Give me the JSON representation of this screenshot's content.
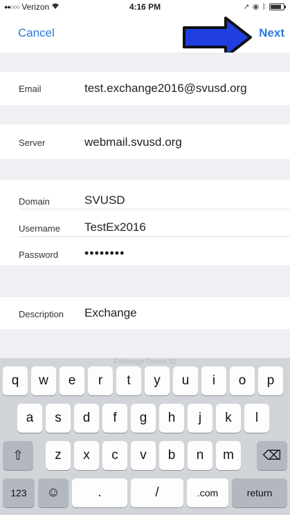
{
  "status_bar": {
    "carrier": "Verizon",
    "time": "4:16 PM"
  },
  "nav": {
    "cancel_label": "Cancel",
    "next_label": "Next",
    "arrow_color": "#1f3fe0"
  },
  "form": {
    "email": {
      "label": "Email",
      "value": "test.exchange2016@svusd.org"
    },
    "server": {
      "label": "Server",
      "value": "webmail.svusd.org"
    },
    "domain": {
      "label": "Domain",
      "value": "SVUSD"
    },
    "username": {
      "label": "Username",
      "value": "TestEx2016"
    },
    "password": {
      "label": "Password",
      "value": "••••••••"
    },
    "description": {
      "label": "Description",
      "value": "Exchange"
    },
    "device_id_peek": "Exchange Device ID"
  },
  "keyboard": {
    "row1": [
      "q",
      "w",
      "e",
      "r",
      "t",
      "y",
      "u",
      "i",
      "o",
      "p"
    ],
    "row2": [
      "a",
      "s",
      "d",
      "f",
      "g",
      "h",
      "j",
      "k",
      "l"
    ],
    "row3": [
      "z",
      "x",
      "c",
      "v",
      "b",
      "n",
      "m"
    ],
    "shift_glyph": "⇧",
    "backspace_glyph": "⌫",
    "numbers_label": "123",
    "emoji_glyph": "☺",
    "period": ".",
    "slash": "/",
    "dotcom": ".com",
    "return_label": "return"
  }
}
